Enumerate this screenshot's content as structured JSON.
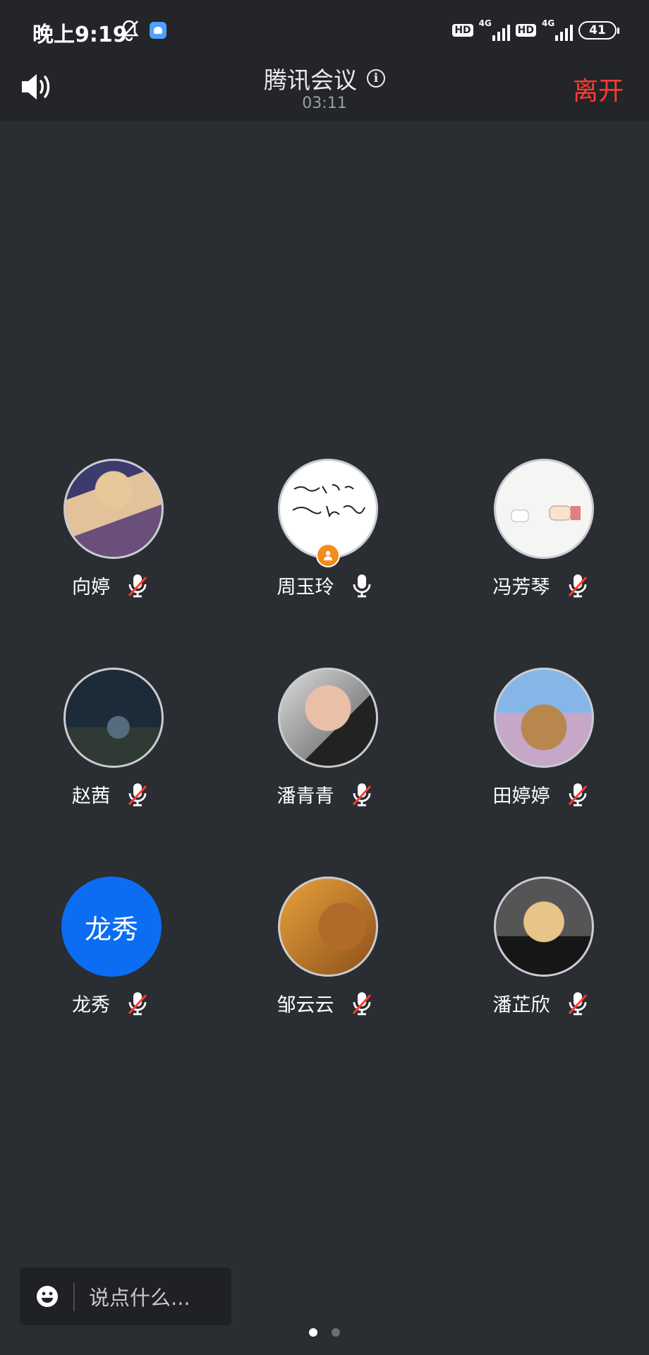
{
  "status_bar": {
    "time": "晚上9:19",
    "hd_label": "HD",
    "network_label": "4G",
    "battery": "41"
  },
  "header": {
    "title": "腾讯会议",
    "info_symbol": "i",
    "timer": "03:11",
    "leave_label": "离开"
  },
  "participants": [
    {
      "name": "向婷",
      "muted": true
    },
    {
      "name": "周玉玲",
      "muted": false,
      "host": true
    },
    {
      "name": "冯芳琴",
      "muted": true
    },
    {
      "name": "赵茜",
      "muted": true
    },
    {
      "name": "潘青青",
      "muted": true
    },
    {
      "name": "田婷婷",
      "muted": true
    },
    {
      "name": "龙秀",
      "muted": true,
      "initials": "龙秀"
    },
    {
      "name": "邹云云",
      "muted": true
    },
    {
      "name": "潘芷欣",
      "muted": true
    }
  ],
  "chat": {
    "placeholder": "说点什么..."
  },
  "colors": {
    "background": "#2a2d32",
    "bar": "#232528",
    "leave": "#ff3b30",
    "initials_avatar": "#0b6df2",
    "host_badge": "#f28c1e"
  },
  "pager": {
    "pages": 2,
    "current": 1
  }
}
